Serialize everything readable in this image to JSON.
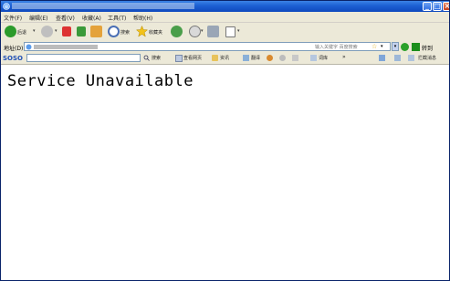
{
  "window": {
    "minimize_label": "_",
    "maximize_label": "□",
    "close_label": "×"
  },
  "menubar": {
    "items": [
      "文件(F)",
      "编辑(E)",
      "查看(V)",
      "收藏(A)",
      "工具(T)",
      "帮助(H)"
    ]
  },
  "toolbar": {
    "back_label": "后退",
    "search_label": "搜索",
    "favorites_label": "收藏夹"
  },
  "address_bar": {
    "label": "地址(D)",
    "hint": "输入关键字  百度搜索",
    "go_label": "转到"
  },
  "links_bar": {
    "logo": "SOSO",
    "search_label": "搜索",
    "items": [
      "查看网页",
      "资讯",
      "翻译",
      "词库"
    ],
    "more": "»",
    "last_item": "拦截消息"
  },
  "page": {
    "message": "Service Unavailable"
  },
  "colors": {
    "titlebar": "#1c5fd3",
    "chrome": "#ece9d8",
    "go_green": "#2aa12a"
  }
}
